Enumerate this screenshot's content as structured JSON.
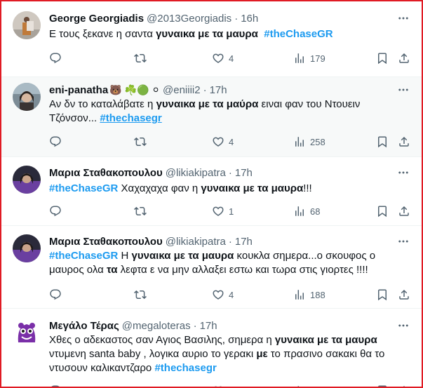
{
  "tweets": [
    {
      "name": "George Georgiadis",
      "handle": "@2013Georgiadis",
      "time": "16h",
      "text_plain": "Ε τους ξεκανε η σαντα ",
      "text_bold": "γυναικα με τα μαυρα",
      "hashtag": "#theChaseGR",
      "likes": "4",
      "views": "179"
    },
    {
      "name": "eni-panatha",
      "name_emoji": "🐻 ☘️🟢 ⚪",
      "handle": "@eniiii2",
      "time": "17h",
      "text_plain": "Αν δν το καταλάβατε η ",
      "text_bold": "γυναικα με τα μαύρα",
      "text_after": " ειναι φαν του Ντουειν",
      "text_line2": "Τζόνσον... ",
      "hashtag": "#thechasegr",
      "likes": "4",
      "views": "258"
    },
    {
      "name": "Μαρια Σταθακοπουλου",
      "handle": "@likiakipatra",
      "time": "17h",
      "hashtag": "#theChaseGR",
      "text_plain": " Χαχαχαχα φαν η ",
      "text_bold": "γυναικα με τα μαυρα",
      "text_after": "!!!",
      "likes": "1",
      "views": "68"
    },
    {
      "name": "Μαρια Σταθακοπουλου",
      "handle": "@likiakipatra",
      "time": "17h",
      "hashtag": "#theChaseGR",
      "text_plain": " Η ",
      "text_bold": "γυναικα με τα μαυρα",
      "text_after": " κουκλα σημερα...ο σκουφος ο",
      "text_line2a": "μαυρος ολα ",
      "text_line2b": "τα",
      "text_line2c": " λεφτα ε να μην αλλαξει εστω και τωρα στις γιορτες !!!!",
      "likes": "4",
      "views": "188"
    },
    {
      "name": "Μεγάλο Τέρας",
      "handle": "@megaloteras",
      "time": "17h",
      "line1": "Χθες ο αδεκαστος σαν Αγιος Βασιλης, σημερα η ",
      "line1_bold": "γυναικα με τα μαυρα",
      "line2a": "ντυμενη santa baby , λογικα αυριο το γερακι ",
      "line2_bold": "με",
      "line2b": " το πρασινο σακακι θα το",
      "line3": "ντυσουν καλικαντζαρο ",
      "hashtag": "#thechasegr"
    }
  ],
  "icons": [
    "more-icon",
    "reply-icon",
    "retweet-icon",
    "like-icon",
    "views-icon",
    "bookmark-icon",
    "share-icon"
  ],
  "colors": {
    "accent": "#1d9bf0",
    "muted": "#536471",
    "border": "#eff3f4",
    "frame": "#e01b24"
  }
}
